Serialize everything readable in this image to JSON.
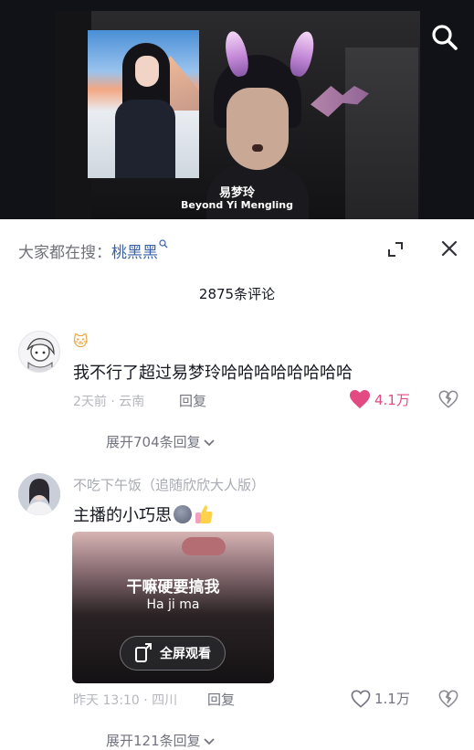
{
  "video": {
    "caption_title": "易梦玲",
    "caption_subtitle": "Beyond Yi Mengling"
  },
  "comments_panel": {
    "hot_search_prefix": "大家都在搜：",
    "hot_search_keyword": "桃黑黑",
    "comment_count_label": "2875条评论"
  },
  "comments": [
    {
      "author_emoji": "🐱",
      "text": "我不行了超过易梦玲哈哈哈哈哈哈哈哈",
      "meta": "2天前 · 云南",
      "reply_label": "回复",
      "like_count": "4.1万",
      "liked": true,
      "expand_label": "展开704条回复"
    },
    {
      "author": "不吃下午饭（追随欣欣大人版）",
      "text": "主播的小巧思",
      "meta": "昨天 13:10 · 四川",
      "reply_label": "回复",
      "like_count": "1.1万",
      "liked": false,
      "expand_label": "展开121条回复",
      "attached_video": {
        "title": "干嘛硬要搞我",
        "subtitle": "Ha ji ma",
        "button_label": "全屏观看"
      }
    }
  ],
  "colors": {
    "like_active": "#e34a82",
    "keyword_link": "#3a62a8",
    "muted_text": "#737480"
  }
}
